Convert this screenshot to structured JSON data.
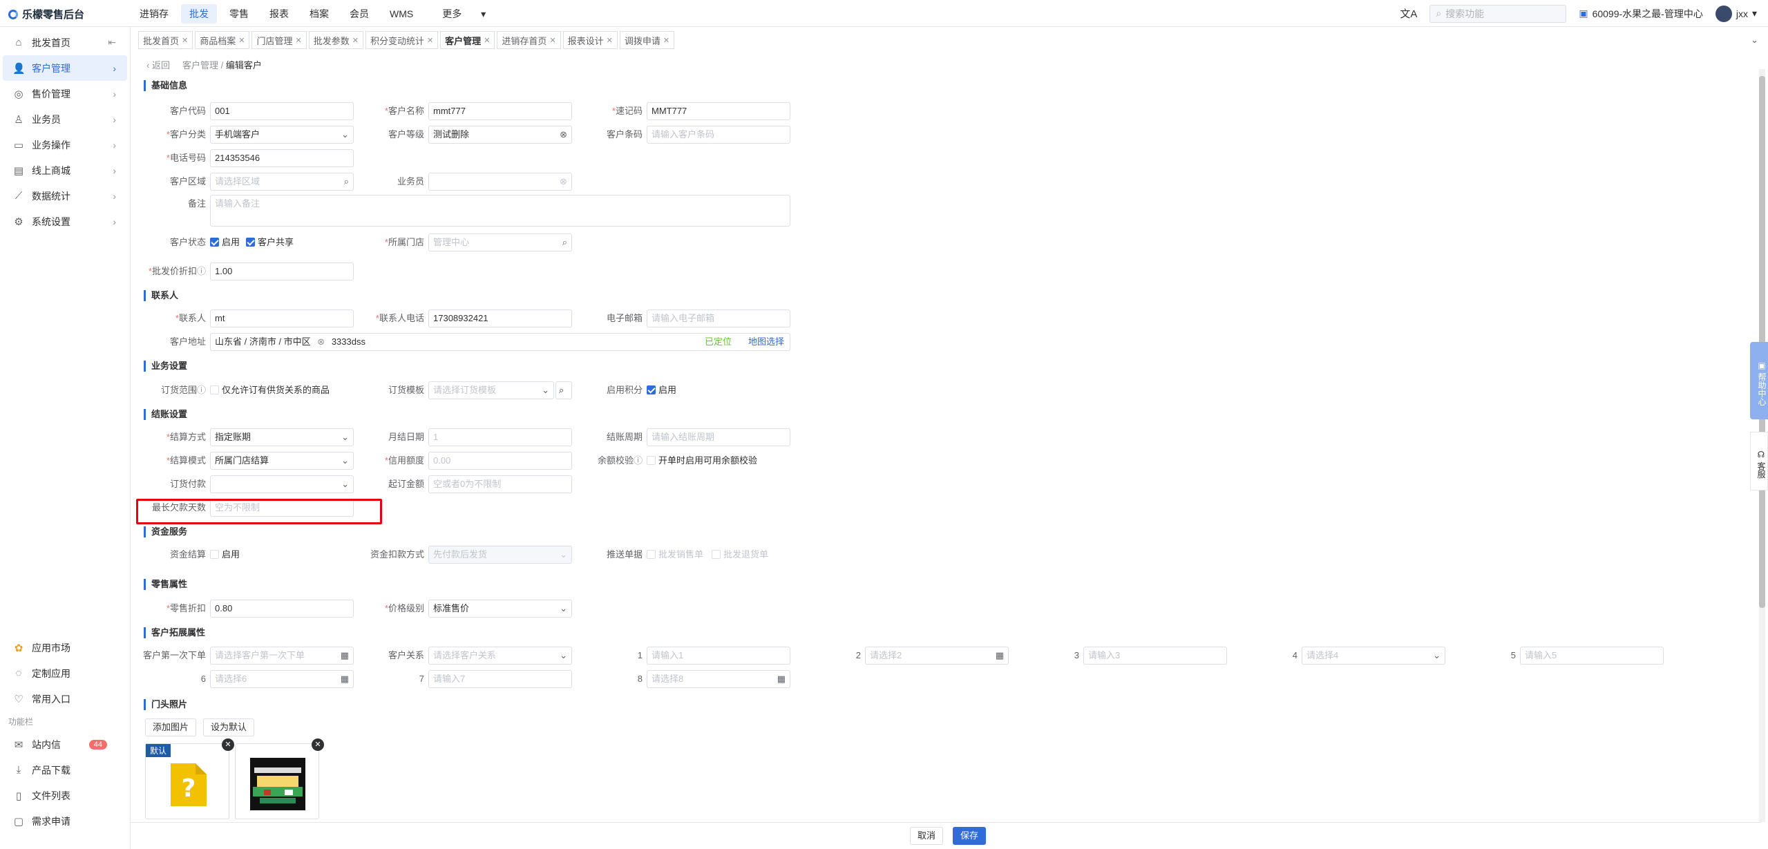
{
  "app": {
    "title": "乐檬零售后台"
  },
  "topnav": [
    "进销存",
    "批发",
    "零售",
    "报表",
    "档案",
    "会员",
    "WMS",
    "更多"
  ],
  "topright": {
    "search_placeholder": "搜索功能",
    "store": "60099-水果之最-管理中心",
    "user": "jxx"
  },
  "sidebar": {
    "items": [
      "批发首页",
      "客户管理",
      "售价管理",
      "业务员",
      "业务操作",
      "线上商城",
      "数据统计",
      "系统设置"
    ],
    "bottom": [
      "应用市场",
      "定制应用",
      "常用入口"
    ],
    "section": "功能栏",
    "tools": [
      "站内信",
      "产品下载",
      "文件列表",
      "需求申请"
    ],
    "badge": "44"
  },
  "tabs": [
    "批发首页",
    "商品档案",
    "门店管理",
    "批发参数",
    "积分变动统计",
    "客户管理",
    "进销存首页",
    "报表设计",
    "调拨申请"
  ],
  "breadcrumb": {
    "back": "返回",
    "parent": "客户管理 /",
    "current": "编辑客户"
  },
  "sections": {
    "basic": "基础信息",
    "contact": "联系人",
    "business": "业务设置",
    "settle": "结账设置",
    "fund": "资金服务",
    "retail": "零售属性",
    "ext": "客户拓展属性",
    "photo": "门头照片"
  },
  "form": {
    "code_label": "客户代码",
    "code": "001",
    "name_label": "客户名称",
    "name": "mmt777",
    "quick_label": "速记码",
    "quick": "MMT777",
    "cat_label": "客户分类",
    "cat": "手机端客户",
    "level_label": "客户等级",
    "level": "测试删除",
    "barcode_label": "客户条码",
    "barcode_ph": "请输入客户条码",
    "phone_label": "电话号码",
    "phone": "214353546",
    "area_label": "客户区域",
    "area_ph": "请选择区域",
    "sales_label": "业务员",
    "remark_label": "备注",
    "remark_ph": "请输入备注",
    "status_label": "客户状态",
    "status_on": "启用",
    "shared": "客户共享",
    "store_label": "所属门店",
    "store_ph": "管理中心",
    "discount_label": "批发价折扣",
    "discount": "1.00",
    "contact_label": "联系人",
    "contact": "mt",
    "cphone_label": "联系人电话",
    "cphone": "17308932421",
    "email_label": "电子邮箱",
    "email_ph": "请输入电子邮箱",
    "addr_label": "客户地址",
    "addr_region": "山东省 / 济南市 / 市中区",
    "addr_detail": "3333dss",
    "addr_located": "已定位",
    "addr_map": "地图选择",
    "order_scope_label": "订货范围",
    "order_scope": "仅允许订有供货关系的商品",
    "order_tpl_label": "订货模板",
    "order_tpl_ph": "请选择订货模板",
    "points_label": "启用积分",
    "points": "启用",
    "settle_way_label": "结算方式",
    "settle_way": "指定账期",
    "month_day_label": "月结日期",
    "month_day_ph": "1",
    "period_label": "结账周期",
    "period_ph": "请输入结账周期",
    "settle_mode_label": "结算模式",
    "settle_mode": "所属门店结算",
    "credit_label": "信用额度",
    "credit_ph": "0.00",
    "balance_label": "余额校验",
    "balance": "开单时启用可用余额校验",
    "pay_label": "订货付款",
    "min_amt_label": "起订金额",
    "min_amt_ph": "空或者0为不限制",
    "max_days_label": "最长欠款天数",
    "max_days_ph": "空为不限制",
    "fund_settle_label": "资金结算",
    "fund_settle": "启用",
    "fund_deduct_label": "资金扣款方式",
    "fund_deduct_ph": "先付款后发货",
    "push_label": "推送单据",
    "push1": "批发销售单",
    "push2": "批发退货单",
    "retail_disc_label": "零售折扣",
    "retail_disc": "0.80",
    "price_level_label": "价格级别",
    "price_level": "标准售价",
    "first_order_label": "客户第一次下单",
    "first_order_ph": "请选择客户第一次下单",
    "relation_label": "客户关系",
    "relation_ph": "请选择客户关系",
    "e1_label": "1",
    "e1_ph": "请输入1",
    "e2_label": "2",
    "e2_ph": "请选择2",
    "e3_label": "3",
    "e3_ph": "请输入3",
    "e4_label": "4",
    "e4_ph": "请选择4",
    "e5_label": "5",
    "e5_ph": "请输入5",
    "e6_label": "6",
    "e6_ph": "请选择6",
    "e7_label": "7",
    "e7_ph": "请输入7",
    "e8_label": "8",
    "e8_ph": "请选择8"
  },
  "photo": {
    "add": "添加图片",
    "set_default": "设为默认",
    "default_tag": "默认"
  },
  "float": {
    "help": "帮助中心",
    "service": "客服"
  },
  "footer": {
    "cancel": "取消",
    "save": "保存"
  }
}
